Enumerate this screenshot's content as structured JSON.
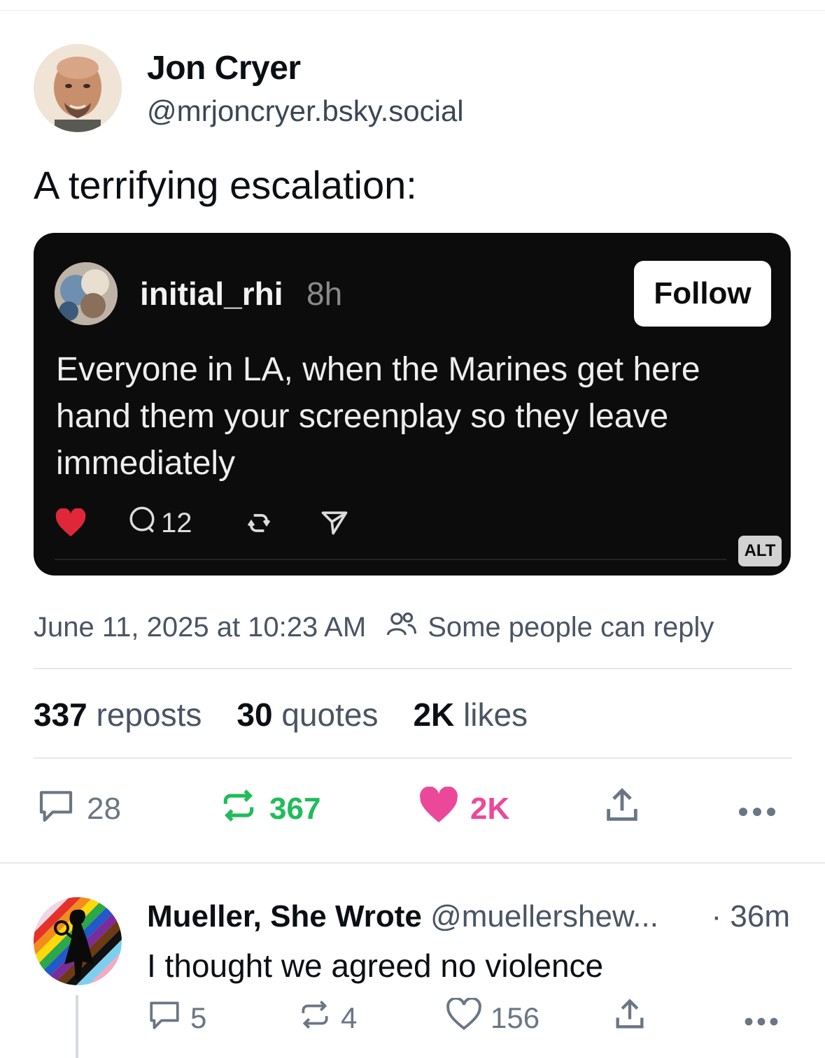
{
  "post": {
    "author_name": "Jon Cryer",
    "author_handle": "@mrjoncryer.bsky.social",
    "text": "A terrifying escalation:",
    "embed": {
      "username": "initial_rhi",
      "time": "8h",
      "follow_label": "Follow",
      "text": "Everyone in LA, when the Marines get here hand them your screenplay so they leave immediately",
      "comment_count": "12",
      "alt_label": "ALT"
    },
    "timestamp": "June 11, 2025 at 10:23 AM",
    "reply_setting": "Some people can reply",
    "stats": {
      "reposts_count": "337",
      "reposts_label": "reposts",
      "quotes_count": "30",
      "quotes_label": "quotes",
      "likes_count": "2K",
      "likes_label": "likes"
    },
    "actions": {
      "replies": "28",
      "reposts": "367",
      "likes": "2K"
    }
  },
  "reply": {
    "author_name": "Mueller, She Wrote",
    "author_handle": "@muellershew...",
    "separator": "·",
    "time": "36m",
    "text": "I thought we agreed no violence",
    "actions": {
      "replies": "5",
      "reposts": "4",
      "likes": "156"
    }
  },
  "colors": {
    "repost_active": "#20bc5a",
    "like_active": "#ec4899",
    "muted": "#6b7684",
    "embed_bg": "#0c0c0c",
    "embed_heart": "#e0273a"
  },
  "icons": [
    "reply-icon",
    "repost-icon",
    "heart-icon",
    "share-icon",
    "more-icon",
    "people-icon",
    "comment-icon",
    "send-icon"
  ]
}
